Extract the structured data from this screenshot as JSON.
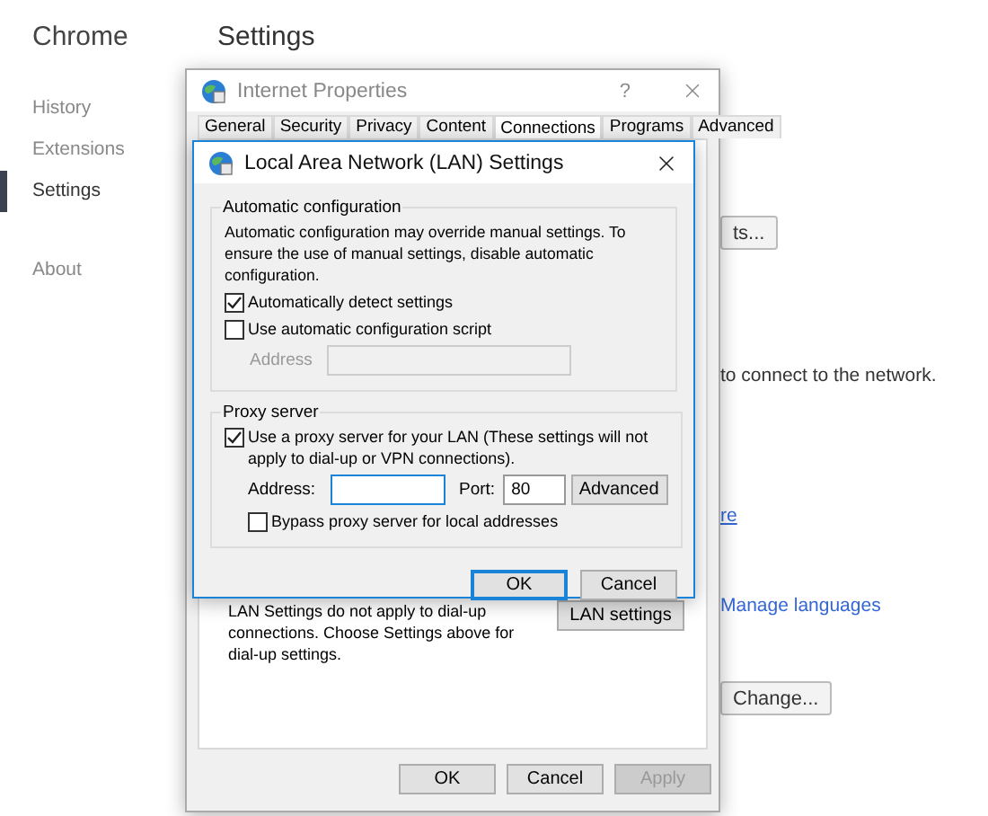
{
  "browser": {
    "title": "Chrome",
    "nav": [
      {
        "label": "History",
        "selected": false
      },
      {
        "label": "Extensions",
        "selected": false
      },
      {
        "label": "Settings",
        "selected": true
      },
      {
        "label": "About",
        "selected": false
      }
    ]
  },
  "page": {
    "heading": "Settings",
    "peek": [
      {
        "kind": "button",
        "text": "ts..."
      },
      {
        "kind": "text",
        "text": "to connect to the network."
      },
      {
        "kind": "link",
        "text": "re"
      },
      {
        "kind": "link",
        "text": "Manage languages"
      },
      {
        "kind": "button",
        "text": "Change..."
      }
    ]
  },
  "internet_properties": {
    "title": "Internet Properties",
    "help": "?",
    "tabs": [
      {
        "label": "General",
        "selected": false
      },
      {
        "label": "Security",
        "selected": false
      },
      {
        "label": "Privacy",
        "selected": false
      },
      {
        "label": "Content",
        "selected": false
      },
      {
        "label": "Connections",
        "selected": true
      },
      {
        "label": "Programs",
        "selected": false
      },
      {
        "label": "Advanced",
        "selected": false
      }
    ],
    "lan_note": "LAN Settings do not apply to dial-up connections. Choose Settings above for dial-up settings.",
    "lan_button": "LAN settings",
    "buttons": [
      {
        "label": "OK",
        "disabled": false
      },
      {
        "label": "Cancel",
        "disabled": false
      },
      {
        "label": "Apply",
        "disabled": true
      }
    ]
  },
  "lan_dialog": {
    "title": "Local Area Network (LAN) Settings",
    "auto_group": {
      "title": "Automatic configuration",
      "note": "Automatic configuration may override manual settings.  To ensure the use of manual settings, disable automatic configuration.",
      "options": [
        {
          "label": "Automatically detect settings",
          "checked": true
        },
        {
          "label": "Use automatic configuration script",
          "checked": false
        }
      ],
      "address": {
        "label": "Address",
        "disabled": true
      }
    },
    "proxy_group": {
      "title": "Proxy server",
      "use_proxy": {
        "label": "Use a proxy server for your LAN (These settings will not apply to dial-up or VPN connections).",
        "checked": true
      },
      "address_label": "Address:",
      "port_label": "Port:",
      "port": "80",
      "advanced": "Advanced",
      "bypass": {
        "label": "Bypass proxy server for local addresses",
        "checked": false
      }
    },
    "buttons": [
      {
        "label": "OK",
        "default": true
      },
      {
        "label": "Cancel",
        "default": false
      }
    ]
  }
}
